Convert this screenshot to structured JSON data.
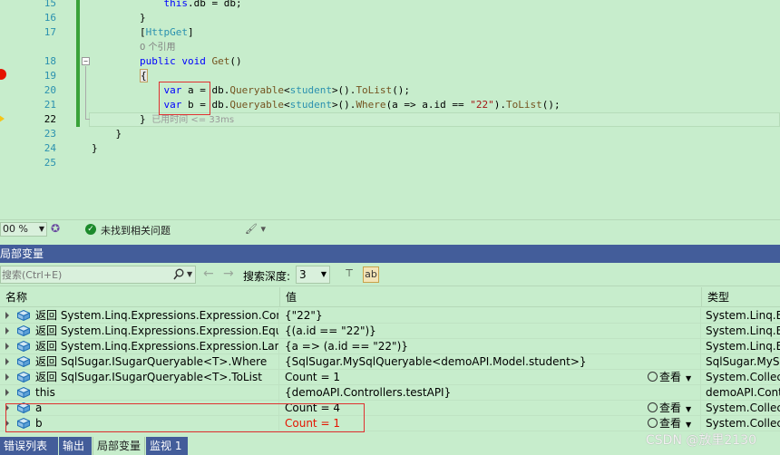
{
  "editor": {
    "lines": [
      {
        "num": "15",
        "html": "            <span class=\"kw\">this</span>.db = db;"
      },
      {
        "num": "16",
        "html": "        }"
      },
      {
        "num": "17",
        "html": "        [<span class=\"at\">HttpGet</span>]"
      },
      {
        "num": "",
        "html": "        <span class=\"cm\">0 个引用</span>"
      },
      {
        "num": "18",
        "html": "        <span class=\"kw\">public void</span> <span class=\"mt\">Get</span>()"
      },
      {
        "num": "19",
        "html": "        <span class=\"brace-hl2\">{</span>"
      },
      {
        "num": "20",
        "html": "            <span class=\"kw\">var</span> a = db.<span class=\"mt\">Queryable</span>&lt;<span class=\"ty\">student</span>&gt;().<span class=\"mt\">ToList</span>();"
      },
      {
        "num": "21",
        "html": "            <span class=\"kw\">var</span> b = db.<span class=\"mt\">Queryable</span>&lt;<span class=\"ty\">student</span>&gt;().<span class=\"mt\">Where</span>(a =&gt; a.id == <span class=\"st\">\"22\"</span>).<span class=\"mt\">ToList</span>();"
      },
      {
        "num": "22",
        "html": "        } <span class=\"hint\">已用时间 &lt;= 33ms</span>"
      },
      {
        "num": "23",
        "html": "    }"
      },
      {
        "num": "24",
        "html": "}"
      },
      {
        "num": "25",
        "html": ""
      }
    ]
  },
  "status": {
    "zoom": "00 %",
    "issues": "未找到相关问题"
  },
  "locals": {
    "title": "局部变量",
    "search_placeholder": "搜索(Ctrl+E)",
    "depth_label": "搜索深度:",
    "depth_value": "3",
    "columns": {
      "name": "名称",
      "value": "值",
      "type": "类型"
    },
    "rows": [
      {
        "name": "返回 System.Linq.Expressions.Expression.Constant",
        "value": "{\"22\"}",
        "type": "System.Linq.Exp",
        "view": ""
      },
      {
        "name": "返回 System.Linq.Expressions.Expression.Equal",
        "value": "{(a.id == \"22\")}",
        "type": "System.Linq.Exp",
        "view": ""
      },
      {
        "name": "返回 System.Linq.Expressions.Expression.Lambd...",
        "value": "{a => (a.id == \"22\")}",
        "type": "System.Linq.Exp",
        "view": ""
      },
      {
        "name": "返回 SqlSugar.ISugarQueryable<T>.Where",
        "value": "{SqlSugar.MySqlQueryable<demoAPI.Model.student>}",
        "type": "SqlSugar.MySqlQ",
        "view": ""
      },
      {
        "name": "返回 SqlSugar.ISugarQueryable<T>.ToList",
        "value": "Count = 1",
        "type": "System.Collectio",
        "view": "查看"
      },
      {
        "name": "this",
        "value": "{demoAPI.Controllers.testAPI}",
        "type": "demoAPI.Contro",
        "view": ""
      },
      {
        "name": "a",
        "value": "Count = 4",
        "type": "System.Collectio",
        "view": "查看"
      },
      {
        "name": "b",
        "value": "Count = 1",
        "type": "System.Collectio",
        "view": "查看"
      }
    ]
  },
  "tabs": [
    {
      "label": "错误列表 ..."
    },
    {
      "label": "输出"
    },
    {
      "label": "局部变量"
    },
    {
      "label": "监视 1"
    }
  ],
  "watermark": "CSDN @放里2130"
}
